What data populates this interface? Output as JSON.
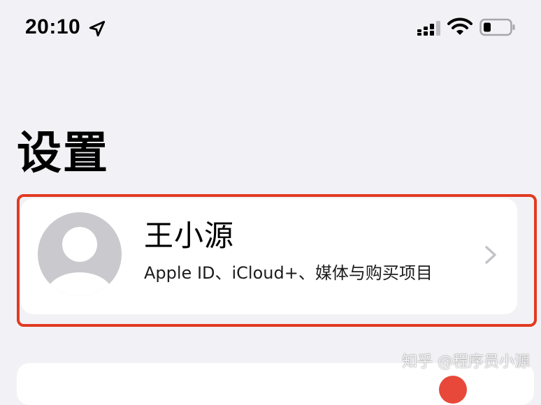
{
  "status_bar": {
    "time": "20:10",
    "icons": [
      "location-icon",
      "signal-icon",
      "wifi-icon",
      "battery-icon"
    ]
  },
  "page": {
    "title": "设置"
  },
  "profile": {
    "name": "王小源",
    "subtitle": "Apple ID、iCloud+、媒体与购买项目",
    "avatar_icon": "person-avatar-icon",
    "chevron_icon": "chevron-right-icon"
  },
  "annotation": {
    "highlight_color": "#e23a22"
  },
  "watermark": {
    "text": "知乎 @程序员小源"
  },
  "colors": {
    "background": "#f2f2f6",
    "card": "#ffffff",
    "badge": "#e8483a"
  }
}
